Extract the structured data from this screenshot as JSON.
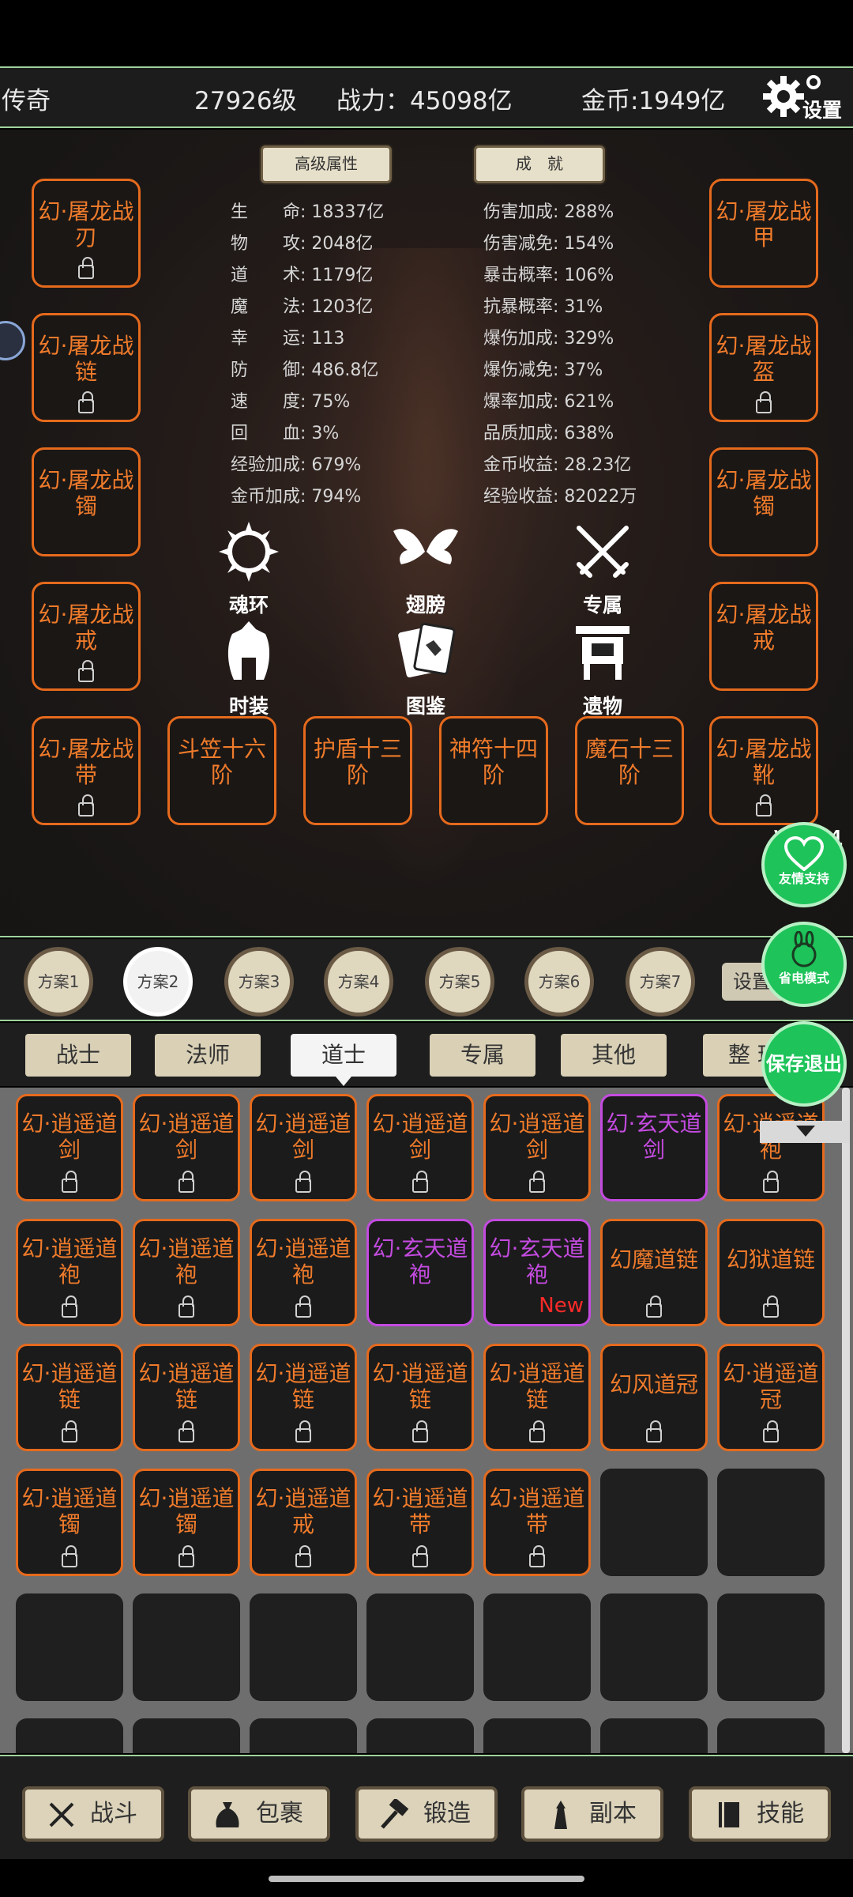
{
  "header": {
    "title": "传奇",
    "level": "27926级",
    "power": "战力：45098亿",
    "gold": "金币:1949亿",
    "settings_label": "设置"
  },
  "panel": {
    "attr_button": "高级属性",
    "achieve_button": "成　就",
    "left_slots": [
      {
        "l1": "幻·屠龙战",
        "l2": "刃"
      },
      {
        "l1": "幻·屠龙战",
        "l2": "链"
      },
      {
        "l1": "幻·屠龙战",
        "l2": "镯"
      },
      {
        "l1": "幻·屠龙战",
        "l2": "戒"
      },
      {
        "l1": "幻·屠龙战",
        "l2": "带"
      }
    ],
    "right_slots": [
      {
        "l1": "幻·屠龙战",
        "l2": "甲"
      },
      {
        "l1": "幻·屠龙战",
        "l2": "盔"
      },
      {
        "l1": "幻·屠龙战",
        "l2": "镯"
      },
      {
        "l1": "幻·屠龙战",
        "l2": "戒"
      },
      {
        "l1": "幻·屠龙战",
        "l2": "靴"
      }
    ],
    "bottom_slots": [
      {
        "l1": "斗笠十六",
        "l2": "阶"
      },
      {
        "l1": "护盾十三",
        "l2": "阶"
      },
      {
        "l1": "神符十四",
        "l2": "阶"
      },
      {
        "l1": "魔石十三",
        "l2": "阶"
      }
    ],
    "stats_left": [
      {
        "k": "生　　命:",
        "v": "18337亿"
      },
      {
        "k": "物　　攻:",
        "v": "2048亿"
      },
      {
        "k": "道　　术:",
        "v": "1179亿"
      },
      {
        "k": "魔　　法:",
        "v": "1203亿"
      },
      {
        "k": "幸　　运:",
        "v": "113"
      },
      {
        "k": "防　　御:",
        "v": "486.8亿"
      },
      {
        "k": "速　　度:",
        "v": "75%"
      },
      {
        "k": "回　　血:",
        "v": "3%"
      },
      {
        "k": "经验加成:",
        "v": "679%"
      },
      {
        "k": "金币加成:",
        "v": "794%"
      }
    ],
    "stats_right": [
      {
        "k": "伤害加成:",
        "v": "288%"
      },
      {
        "k": "伤害减免:",
        "v": "154%"
      },
      {
        "k": "暴击概率:",
        "v": "106%"
      },
      {
        "k": "抗暴概率:",
        "v": "31%"
      },
      {
        "k": "爆伤加成:",
        "v": "329%"
      },
      {
        "k": "爆伤减免:",
        "v": "37%"
      },
      {
        "k": "爆率加成:",
        "v": "621%"
      },
      {
        "k": "品质加成:",
        "v": "638%"
      },
      {
        "k": "金币收益:",
        "v": "28.23亿"
      },
      {
        "k": "经验收益:",
        "v": "82022万"
      }
    ],
    "features": [
      "魂环",
      "翅膀",
      "专属",
      "时装",
      "图鉴",
      "遗物"
    ],
    "version": "V204"
  },
  "floating": {
    "support": "友情支持",
    "power_save": "省电模式",
    "save_exit": "保存退出"
  },
  "plans": {
    "items": [
      "方案1",
      "方案2",
      "方案3",
      "方案4",
      "方案5",
      "方案6",
      "方案7"
    ],
    "active_index": 1,
    "set_label": "设置"
  },
  "tabs": {
    "items": [
      "战士",
      "法师",
      "道士",
      "专属",
      "其他"
    ],
    "active": "道士",
    "sort_label": "整 理"
  },
  "inventory": {
    "rows": [
      [
        {
          "l1": "幻·逍遥道",
          "l2": "剑",
          "color": "orange",
          "lock": true
        },
        {
          "l1": "幻·逍遥道",
          "l2": "剑",
          "color": "orange",
          "lock": true
        },
        {
          "l1": "幻·逍遥道",
          "l2": "剑",
          "color": "orange",
          "lock": true
        },
        {
          "l1": "幻·逍遥道",
          "l2": "剑",
          "color": "orange",
          "lock": true
        },
        {
          "l1": "幻·逍遥道",
          "l2": "剑",
          "color": "orange",
          "lock": true
        },
        {
          "l1": "幻·玄天道",
          "l2": "剑",
          "color": "purple",
          "lock": false
        },
        {
          "l1": "幻·逍遥道",
          "l2": "袍",
          "color": "orange",
          "lock": true
        }
      ],
      [
        {
          "l1": "幻·逍遥道",
          "l2": "袍",
          "color": "orange",
          "lock": true
        },
        {
          "l1": "幻·逍遥道",
          "l2": "袍",
          "color": "orange",
          "lock": true
        },
        {
          "l1": "幻·逍遥道",
          "l2": "袍",
          "color": "orange",
          "lock": true
        },
        {
          "l1": "幻·玄天道",
          "l2": "袍",
          "color": "purple",
          "lock": false
        },
        {
          "l1": "幻·玄天道",
          "l2": "袍",
          "color": "purple",
          "lock": false,
          "new": "New"
        },
        {
          "l1": "幻魔道链",
          "l2": "",
          "color": "orange",
          "lock": true
        },
        {
          "l1": "幻狱道链",
          "l2": "",
          "color": "orange",
          "lock": true
        }
      ],
      [
        {
          "l1": "幻·逍遥道",
          "l2": "链",
          "color": "orange",
          "lock": true
        },
        {
          "l1": "幻·逍遥道",
          "l2": "链",
          "color": "orange",
          "lock": true
        },
        {
          "l1": "幻·逍遥道",
          "l2": "链",
          "color": "orange",
          "lock": true
        },
        {
          "l1": "幻·逍遥道",
          "l2": "链",
          "color": "orange",
          "lock": true
        },
        {
          "l1": "幻·逍遥道",
          "l2": "链",
          "color": "orange",
          "lock": true
        },
        {
          "l1": "幻风道冠",
          "l2": "",
          "color": "orange",
          "lock": true
        },
        {
          "l1": "幻·逍遥道",
          "l2": "冠",
          "color": "orange",
          "lock": true
        }
      ],
      [
        {
          "l1": "幻·逍遥道",
          "l2": "镯",
          "color": "orange",
          "lock": true
        },
        {
          "l1": "幻·逍遥道",
          "l2": "镯",
          "color": "orange",
          "lock": true
        },
        {
          "l1": "幻·逍遥道",
          "l2": "戒",
          "color": "orange",
          "lock": true
        },
        {
          "l1": "幻·逍遥道",
          "l2": "带",
          "color": "orange",
          "lock": true
        },
        {
          "l1": "幻·逍遥道",
          "l2": "带",
          "color": "orange",
          "lock": true
        },
        null,
        null
      ]
    ]
  },
  "bottom_nav": [
    "战斗",
    "包裹",
    "锻造",
    "副本",
    "技能"
  ],
  "colors": {
    "orange": "#e56a1d",
    "purple": "#c44be0",
    "green": "#1ec35a",
    "divider": "#9fd39c"
  }
}
